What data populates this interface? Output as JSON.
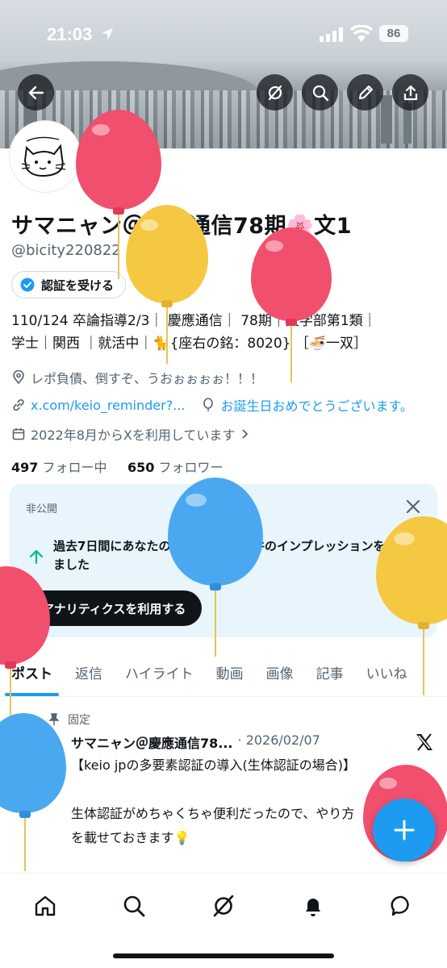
{
  "status_bar": {
    "time": "21:03",
    "battery": "86"
  },
  "header_actions": [
    "back-icon",
    "grok-icon",
    "search-icon",
    "edit-icon",
    "share-icon"
  ],
  "profile": {
    "name": "サマニャン＠慶應通信78期🌸文1",
    "handle": "@bicity220822",
    "verify_label": "認証を受ける",
    "bio_line1": "110/124 卒論指導2/3｜ 慶應通信｜ 78期｜文学部第1類｜",
    "bio_line2": "学士｜関西 ｜就活中｜🐈{座右の銘：8020} ［🍜一双］",
    "location": "レポ負債、倒すぞ、うおぉぉぉぉ！！！",
    "link": "x.com/keio_reminder?...",
    "birthday": "お誕生日おめでとうございます。",
    "joined": "2022年8月からXを利用しています",
    "following_count": "497",
    "following_label": "フォロー中",
    "followers_count": "650",
    "followers_label": "フォロワー"
  },
  "analytics_card": {
    "private_label": "非公開",
    "message": "過去7日間にあなたのポストは1.4万件のインプレッションを獲得しました",
    "cta": "アナリティクスを利用する"
  },
  "tabs": [
    "ポスト",
    "返信",
    "ハイライト",
    "動画",
    "画像",
    "記事",
    "いいね"
  ],
  "pinned_post": {
    "pinned_label": "固定",
    "author": "サマニャン＠慶應通信78...",
    "date": "· 2026/02/07",
    "body": "【keio jpの多要素認証の導入(生体認証の場合)】\n\n生体認証がめちゃくちゃ便利だったので、やり方\nを載せておきます💡\n\n・変更点(生体認証の場合)"
  },
  "bottom_nav": [
    "home-icon",
    "search-icon",
    "grok-icon",
    "notifications-icon",
    "messages-icon"
  ],
  "colors": {
    "accent": "#1d9bf0",
    "balloon_red": "#f0506e",
    "balloon_yellow": "#f5c842",
    "balloon_blue": "#4aa8f0"
  }
}
